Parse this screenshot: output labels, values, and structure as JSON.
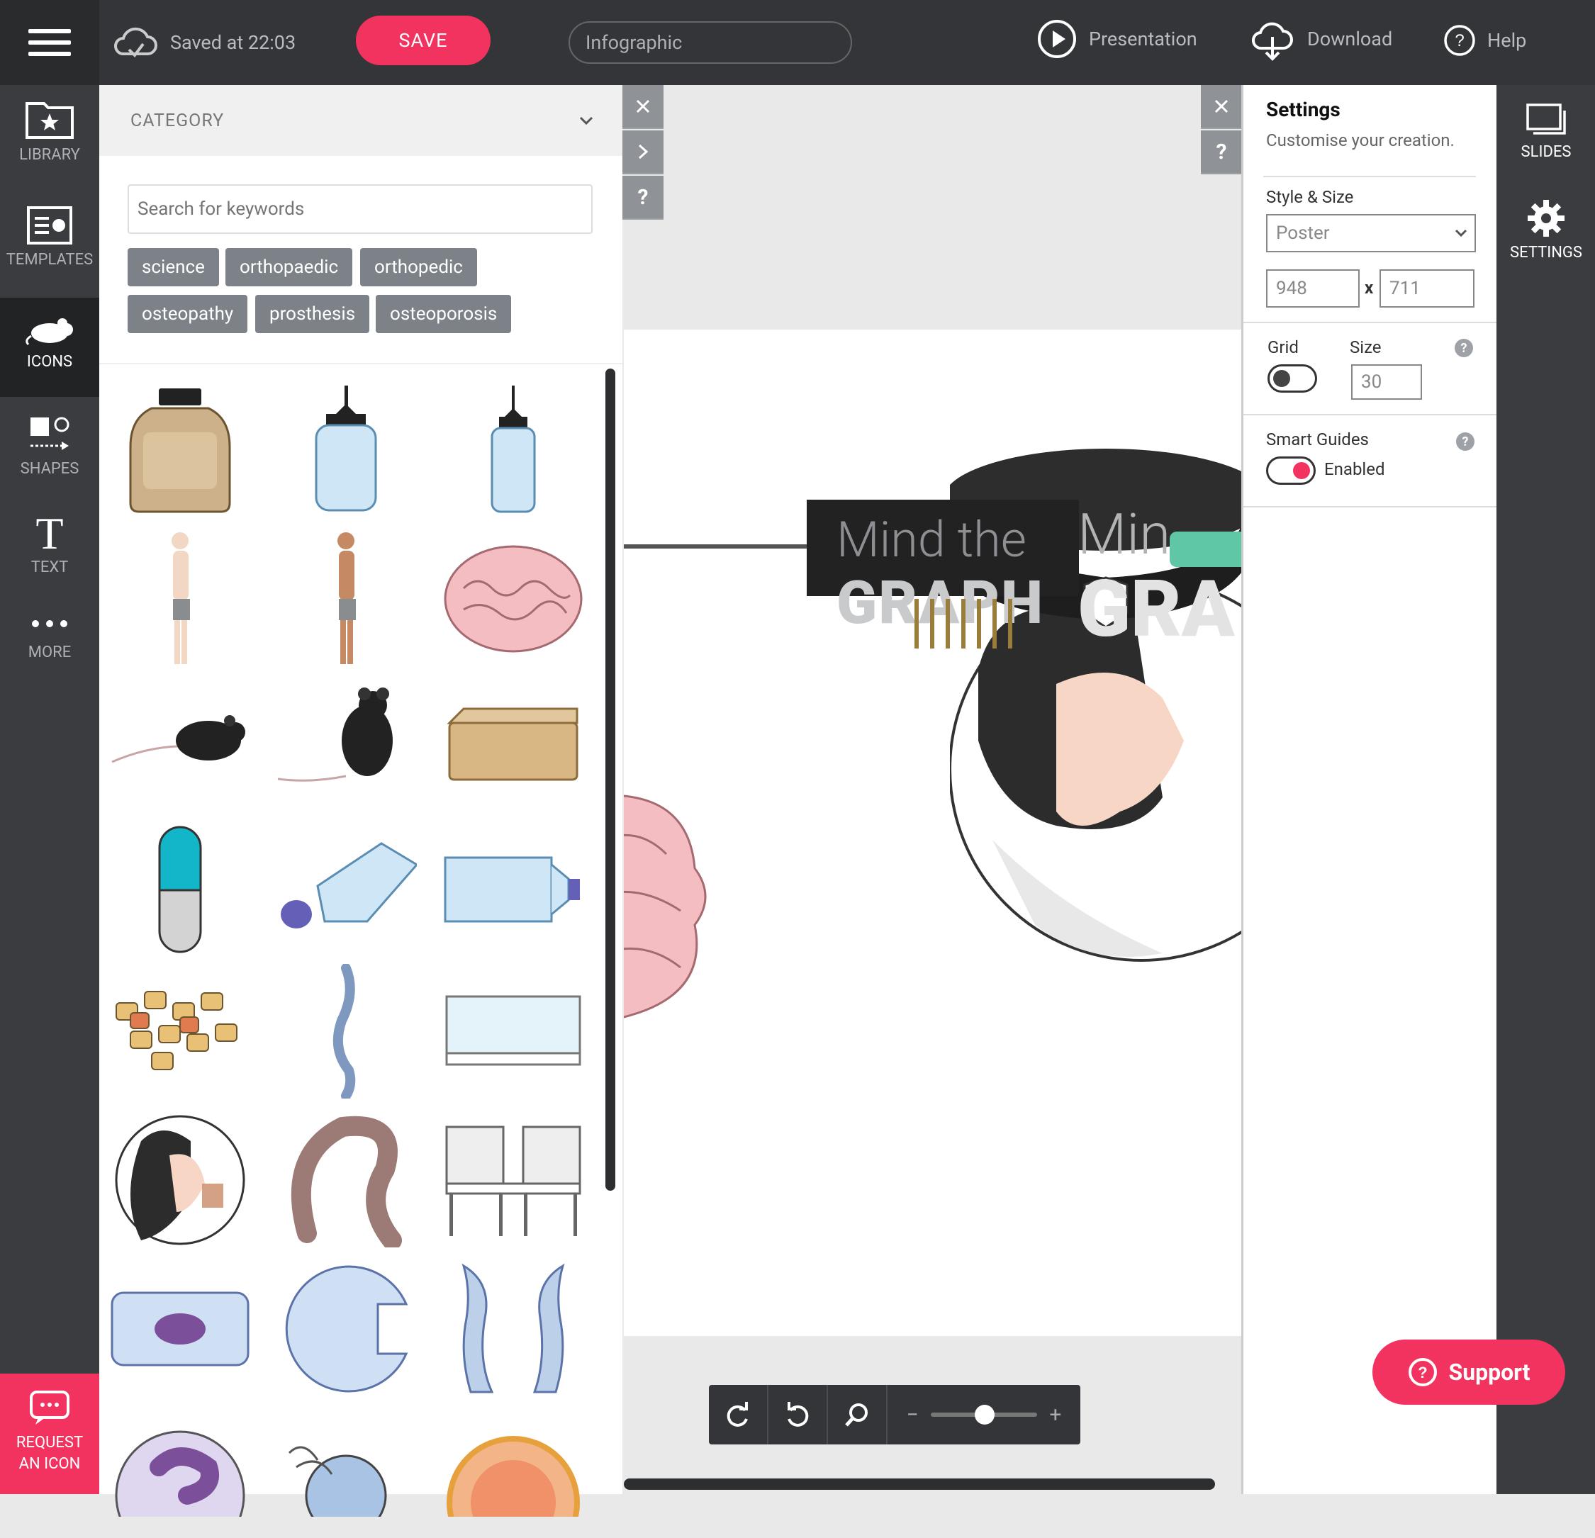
{
  "topbar": {
    "saved_text": "Saved at 22:03",
    "save_label": "SAVE",
    "title_value": "Infographic",
    "presentation_label": "Presentation",
    "download_label": "Download",
    "help_label": "Help"
  },
  "left_rail": {
    "library": "LIBRARY",
    "templates": "TEMPLATES",
    "icons": "ICONS",
    "shapes": "SHAPES",
    "text": "TEXT",
    "more": "MORE",
    "request_line1": "REQUEST",
    "request_line2": "AN ICON"
  },
  "panel": {
    "category_label": "CATEGORY",
    "search_placeholder": "Search for keywords",
    "tags": [
      "science",
      "orthopaedic",
      "orthopedic",
      "osteopathy",
      "prosthesis",
      "osteoporosis"
    ]
  },
  "canvas": {
    "watermark_line1": "Mind the",
    "watermark_line2": "GRAPH",
    "watermark_partial1": "Min",
    "watermark_partial2": "GRA"
  },
  "settings": {
    "title": "Settings",
    "subtitle": "Customise your creation.",
    "style_size_label": "Style & Size",
    "style_value": "Poster",
    "width": "948",
    "times": "x",
    "height": "711",
    "grid_label": "Grid",
    "size_label": "Size",
    "grid_size": "30",
    "smart_guides_label": "Smart Guides",
    "smart_guides_state": "Enabled"
  },
  "right_rail": {
    "slides": "SLIDES",
    "settings": "SETTINGS"
  },
  "support_label": "Support",
  "colors": {
    "accent": "#f2325f",
    "dark": "#333538"
  }
}
